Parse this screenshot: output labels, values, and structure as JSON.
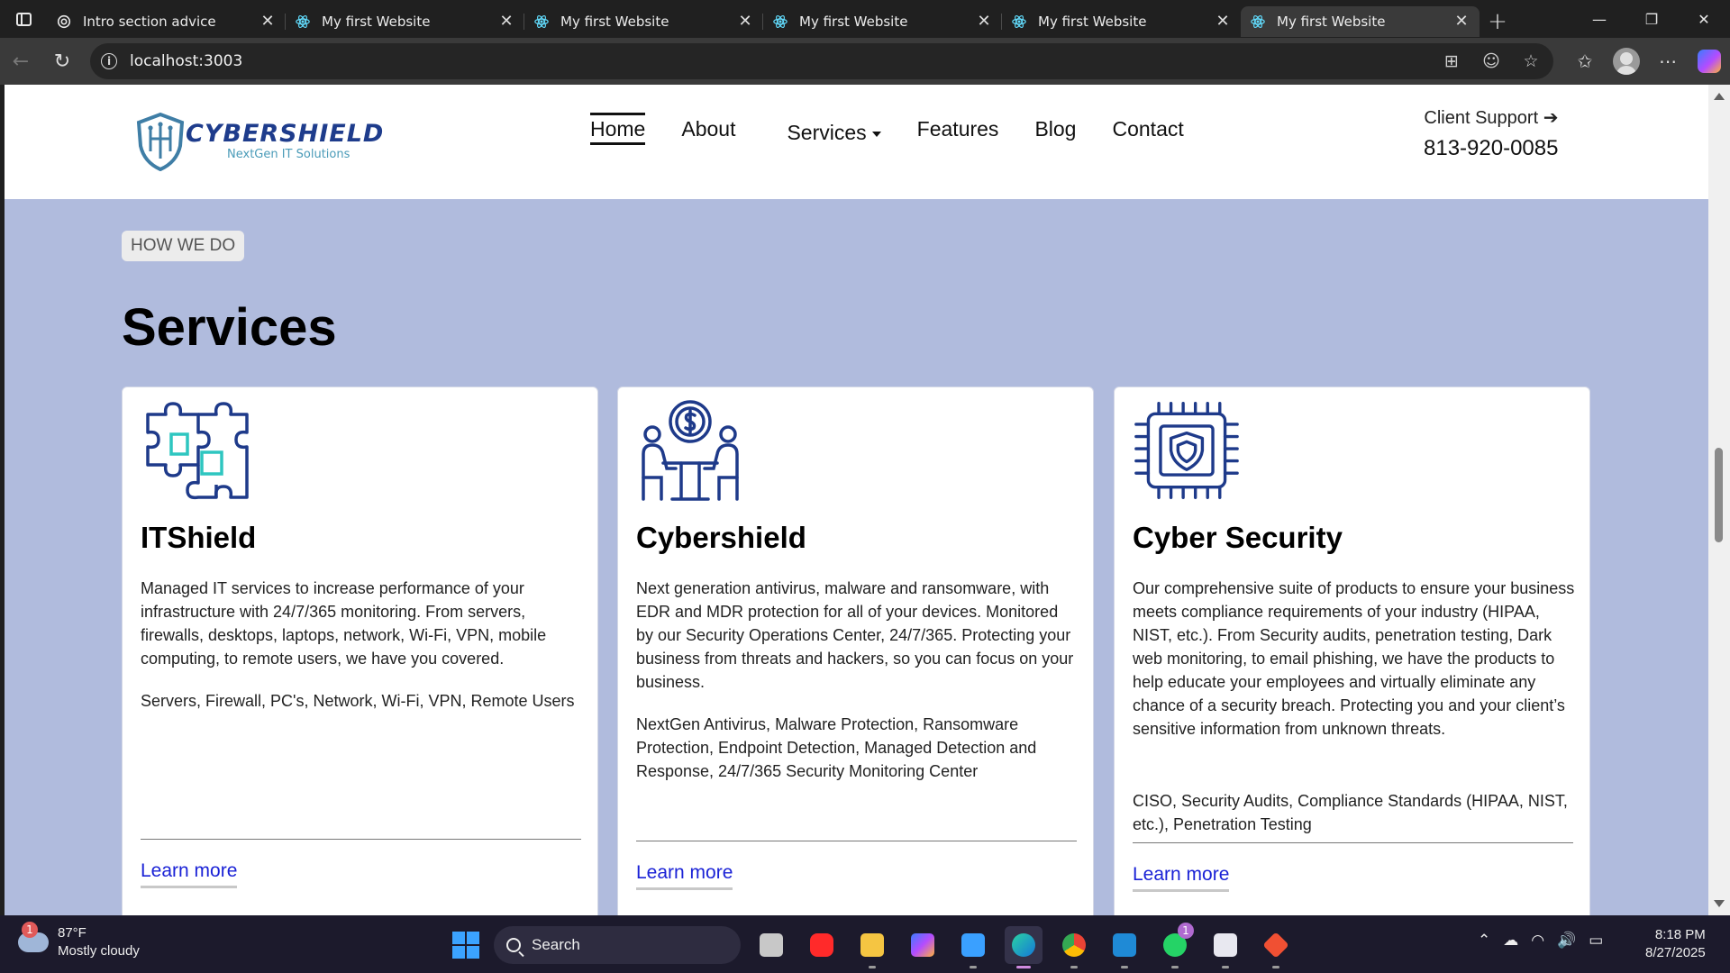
{
  "browser": {
    "tabs": [
      {
        "title": "Intro section advice",
        "favicon": "openai-icon",
        "active": false
      },
      {
        "title": "My first Website",
        "favicon": "react-icon",
        "active": false
      },
      {
        "title": "My first Website",
        "favicon": "react-icon",
        "active": false
      },
      {
        "title": "My first Website",
        "favicon": "react-icon",
        "active": false
      },
      {
        "title": "My first Website",
        "favicon": "react-icon",
        "active": false
      },
      {
        "title": "My first Website",
        "favicon": "react-icon",
        "active": true
      }
    ],
    "url": "localhost:3003"
  },
  "site": {
    "logo": {
      "name": "CYBERSHIELD",
      "tagline": "NextGen IT Solutions"
    },
    "nav": {
      "home": "Home",
      "about": "About",
      "services": "Services",
      "features": "Features",
      "blog": "Blog",
      "contact": "Contact"
    },
    "support": {
      "label": "Client Support",
      "phone": "813-920-0085"
    },
    "section": {
      "eyebrow": "HOW WE DO",
      "title": "Services"
    },
    "cards": [
      {
        "icon": "puzzle-icon",
        "title": "ITShield",
        "description": "Managed IT services to increase performance of your infrastructure with 24/7/365 monitoring. From servers, firewalls, desktops, laptops, network, Wi-Fi, VPN, mobile computing, to remote users, we have you covered.",
        "tags": "Servers, Firewall, PC's, Network, Wi-Fi, VPN, Remote Users",
        "link": "Learn more"
      },
      {
        "icon": "business-meeting-icon",
        "title": "Cybershield",
        "description": "Next generation antivirus, malware and ransomware, with EDR and MDR protection for all of your devices. Monitored by our Security Operations Center, 24/7/365. Protecting your business from threats and hackers, so you can focus on your business.",
        "tags": "NextGen Antivirus, Malware Protection, Ransomware Protection, Endpoint Detection, Managed Detection and Response, 24/7/365 Security Monitoring Center",
        "link": "Learn more"
      },
      {
        "icon": "shield-chip-icon",
        "title": "Cyber Security",
        "description": "Our comprehensive suite of products to ensure your business meets compliance requirements of your industry (HIPAA, NIST, etc.). From Security audits, penetration testing, Dark web monitoring, to email phishing, we have the products to help educate your employees and virtually eliminate any chance of a security breach. Protecting you and your client’s sensitive information from unknown threats.",
        "tags": "CISO, Security Audits, Compliance Standards (HIPAA, NIST, etc.), Penetration Testing",
        "link": "Learn more"
      }
    ]
  },
  "taskbar": {
    "weather": {
      "temp": "87°F",
      "condition": "Mostly cloudy",
      "badge": "1"
    },
    "search_placeholder": "Search",
    "whatsapp_badge": "1",
    "time": "8:18 PM",
    "date": "8/27/2025"
  },
  "colors": {
    "page_bg": "#b0bbdd",
    "link": "#1a22d6",
    "logo": "#1e3c8c",
    "accent_teal": "#2ec6c0"
  }
}
